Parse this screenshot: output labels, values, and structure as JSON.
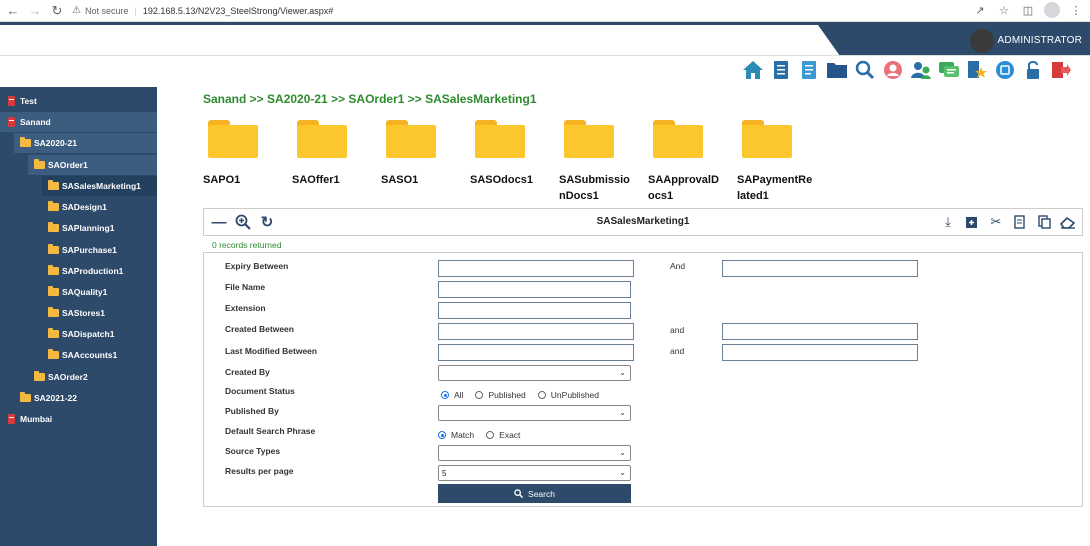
{
  "browser": {
    "security_label": "Not secure",
    "url": "192.168.5.13/N2V23_SteelStrong/Viewer.aspx#"
  },
  "header": {
    "user_name": "ADMINISTRATOR",
    "accent_color": "#2d4a6b"
  },
  "toolbar_icons": [
    "home-icon",
    "document-icon",
    "notes-icon",
    "folder-icon",
    "search-icon",
    "user-icon",
    "users-icon",
    "chat-icon",
    "favorites-icon",
    "info-icon",
    "lock-icon",
    "logout-icon"
  ],
  "sidebar": {
    "items": [
      {
        "label": "Test",
        "type": "book",
        "level": 0
      },
      {
        "label": "Sanand",
        "type": "book",
        "level": 0
      },
      {
        "label": "SA2020-21",
        "type": "folder",
        "level": 1
      },
      {
        "label": "SAOrder1",
        "type": "folder",
        "level": 2
      },
      {
        "label": "SASalesMarketing1",
        "type": "folder",
        "level": 3
      },
      {
        "label": "SADesign1",
        "type": "folder",
        "level": 3
      },
      {
        "label": "SAPlanning1",
        "type": "folder",
        "level": 3
      },
      {
        "label": "SAPurchase1",
        "type": "folder",
        "level": 3
      },
      {
        "label": "SAProduction1",
        "type": "folder",
        "level": 3
      },
      {
        "label": "SAQuality1",
        "type": "folder",
        "level": 3
      },
      {
        "label": "SAStores1",
        "type": "folder",
        "level": 3
      },
      {
        "label": "SADispatch1",
        "type": "folder",
        "level": 3
      },
      {
        "label": "SAAccounts1",
        "type": "folder",
        "level": 3
      },
      {
        "label": "SAOrder2",
        "type": "folder",
        "level": 2
      },
      {
        "label": "SA2021-22",
        "type": "folder",
        "level": 1
      },
      {
        "label": "Mumbai",
        "type": "book",
        "level": 0
      }
    ]
  },
  "breadcrumb": "Sanand >> SA2020-21 >> SAOrder1 >> SASalesMarketing1",
  "folders": [
    "SAPO1",
    "SAOffer1",
    "SASO1",
    "SASOdocs1",
    "SASubmissionDocs1",
    "SAApprovalDocs1",
    "SAPaymentRelated1"
  ],
  "viewer": {
    "title": "SASalesMarketing1",
    "records": "0 records returned"
  },
  "search": {
    "expiry_label": "Expiry Between",
    "expiry_and": "And",
    "file_name_label": "File Name",
    "extension_label": "Extension",
    "created_label": "Created Between",
    "created_and": "and",
    "modified_label": "Last Modified Between",
    "modified_and": "and",
    "created_by_label": "Created By",
    "doc_status_label": "Document Status",
    "doc_status_options": [
      "All",
      "Published",
      "UnPublished"
    ],
    "published_by_label": "Published By",
    "phrase_label": "Default Search Phrase",
    "phrase_options": [
      "Match",
      "Exact"
    ],
    "source_types_label": "Source Types",
    "results_label": "Results per page",
    "results_value": "5",
    "search_button": "Search"
  }
}
